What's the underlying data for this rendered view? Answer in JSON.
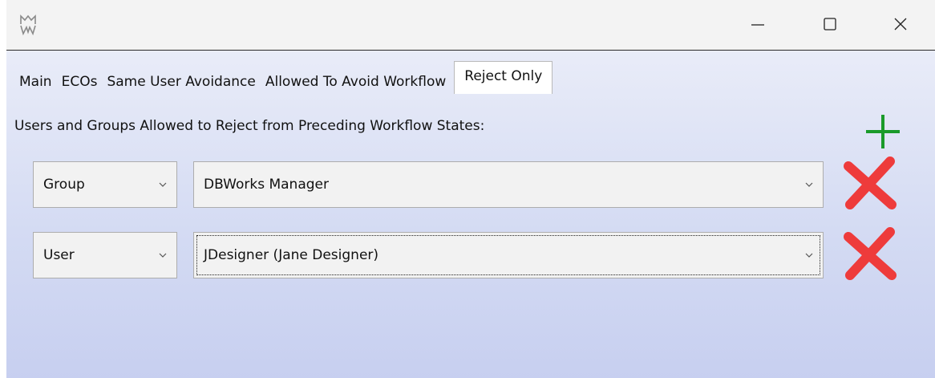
{
  "window": {
    "app_icon": "mw-logo-icon",
    "controls": {
      "minimize": "minimize-icon",
      "maximize": "maximize-icon",
      "close": "close-icon"
    }
  },
  "tabs": [
    {
      "label": "Main",
      "active": false
    },
    {
      "label": "ECOs",
      "active": false
    },
    {
      "label": "Same User Avoidance",
      "active": false
    },
    {
      "label": "Allowed To Avoid Workflow",
      "active": false
    },
    {
      "label": "Reject Only",
      "active": true
    }
  ],
  "section": {
    "label": "Users and Groups Allowed to Reject from Preceding Workflow States:"
  },
  "add_button": {
    "icon": "plus-icon",
    "color": "#1a9a2a"
  },
  "rows": [
    {
      "type": "Group",
      "name": "DBWorks Manager",
      "focused": false
    },
    {
      "type": "User",
      "name": "JDesigner (Jane Designer)",
      "focused": true
    }
  ],
  "delete_button": {
    "icon": "red-x-icon",
    "color": "#ee3b3b"
  }
}
